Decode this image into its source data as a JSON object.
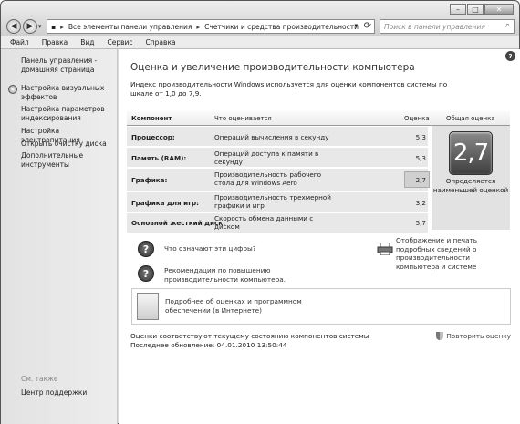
{
  "titlebar": {
    "breadcrumb": [
      "Все элементы панели управления",
      "Счетчики и средства производительности"
    ],
    "search_placeholder": "Поиск в панели управления"
  },
  "menu": [
    "Файл",
    "Правка",
    "Вид",
    "Сервис",
    "Справка"
  ],
  "sidebar": {
    "links": [
      "Панель управления - домашняя страница",
      "Настройка визуальных эффектов",
      "Настройка параметров индексирования",
      "Настройка электропитания",
      "Открыть очистку диска",
      "Дополнительные инструменты"
    ],
    "see_also": "См. также",
    "support": "Центр поддержки"
  },
  "main": {
    "title": "Оценка и увеличение производительности компьютера",
    "intro": "Индекс производительности Windows используется для оценки компонентов системы по шкале от 1,0 до 7,9.",
    "columns": [
      "Компонент",
      "Что оценивается",
      "Оценка",
      "Общая оценка"
    ],
    "rows": [
      {
        "component": "Процессор:",
        "what": "Операций вычисления в секунду",
        "score": "5,3"
      },
      {
        "component": "Память (RAM):",
        "what": "Операций доступа к памяти в секунду",
        "score": "5,3"
      },
      {
        "component": "Графика:",
        "what": "Производительность рабочего стола для Windows Aero",
        "score": "2,7"
      },
      {
        "component": "Графика для игр:",
        "what": "Производительность трехмерной графики и игр",
        "score": "3,2"
      },
      {
        "component": "Основной жесткий диск:",
        "what": "Скорость обмена данными с диском",
        "score": "5,7"
      }
    ],
    "overall_score": "2,7",
    "overall_caption": "Определяется наименьшей оценкой",
    "actions": {
      "what_mean": "Что означают эти цифры?",
      "tips": "Рекомендации по повышению производительности компьютера.",
      "print": "Отображение и печать подробных сведений о производительности компьютера и системе",
      "details": "Подробнее об оценках и программном обеспечении (в Интернете)"
    },
    "footer": {
      "status": "Оценки соответствуют текущему состоянию компонентов системы",
      "last_update": "Последнее обновление: 04.01.2010 13:50:44",
      "rerun": "Повторить оценку"
    }
  }
}
